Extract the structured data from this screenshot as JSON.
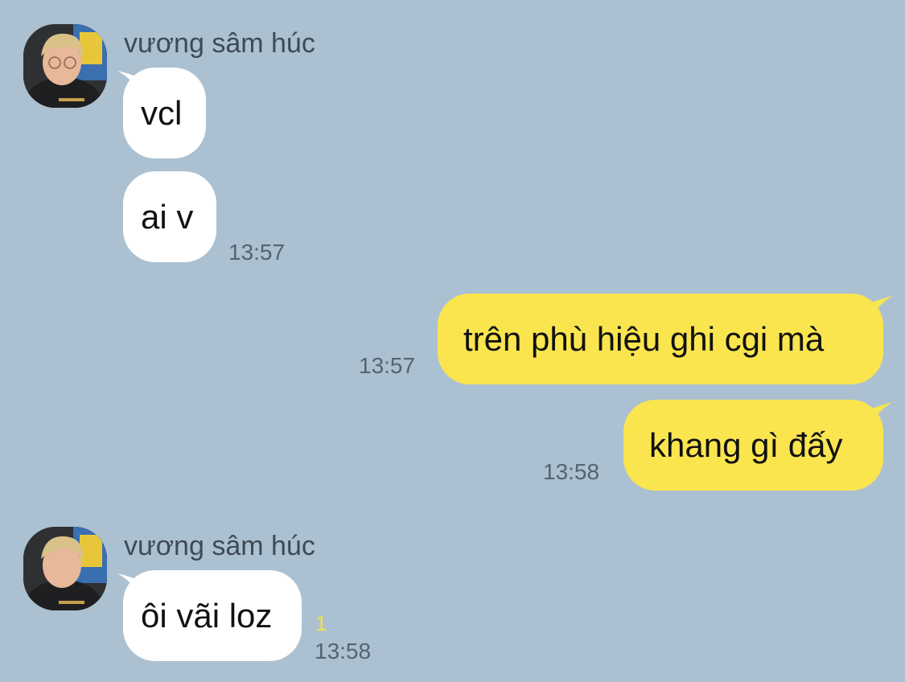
{
  "colors": {
    "background": "#abc1d1",
    "incoming_bubble": "#ffffff",
    "outgoing_bubble": "#fae54f",
    "timestamp": "#556370",
    "unread_count": "#f4e33c"
  },
  "groups": [
    {
      "sender": "vương sâm húc",
      "avatar_icon": "profile-photo-avatar",
      "messages": [
        {
          "text": "vcl"
        },
        {
          "text": "ai v",
          "time": "13:57"
        }
      ]
    },
    {
      "sender": "me",
      "messages": [
        {
          "text": "trên phù hiệu ghi cgi mà",
          "time": "13:57"
        },
        {
          "text": "khang gì đấy",
          "time": "13:58"
        }
      ]
    },
    {
      "sender": "vương sâm húc",
      "avatar_icon": "profile-photo-avatar",
      "messages": [
        {
          "text": "ôi vãi loz",
          "time": "13:58",
          "unread_count": "1"
        }
      ]
    }
  ]
}
